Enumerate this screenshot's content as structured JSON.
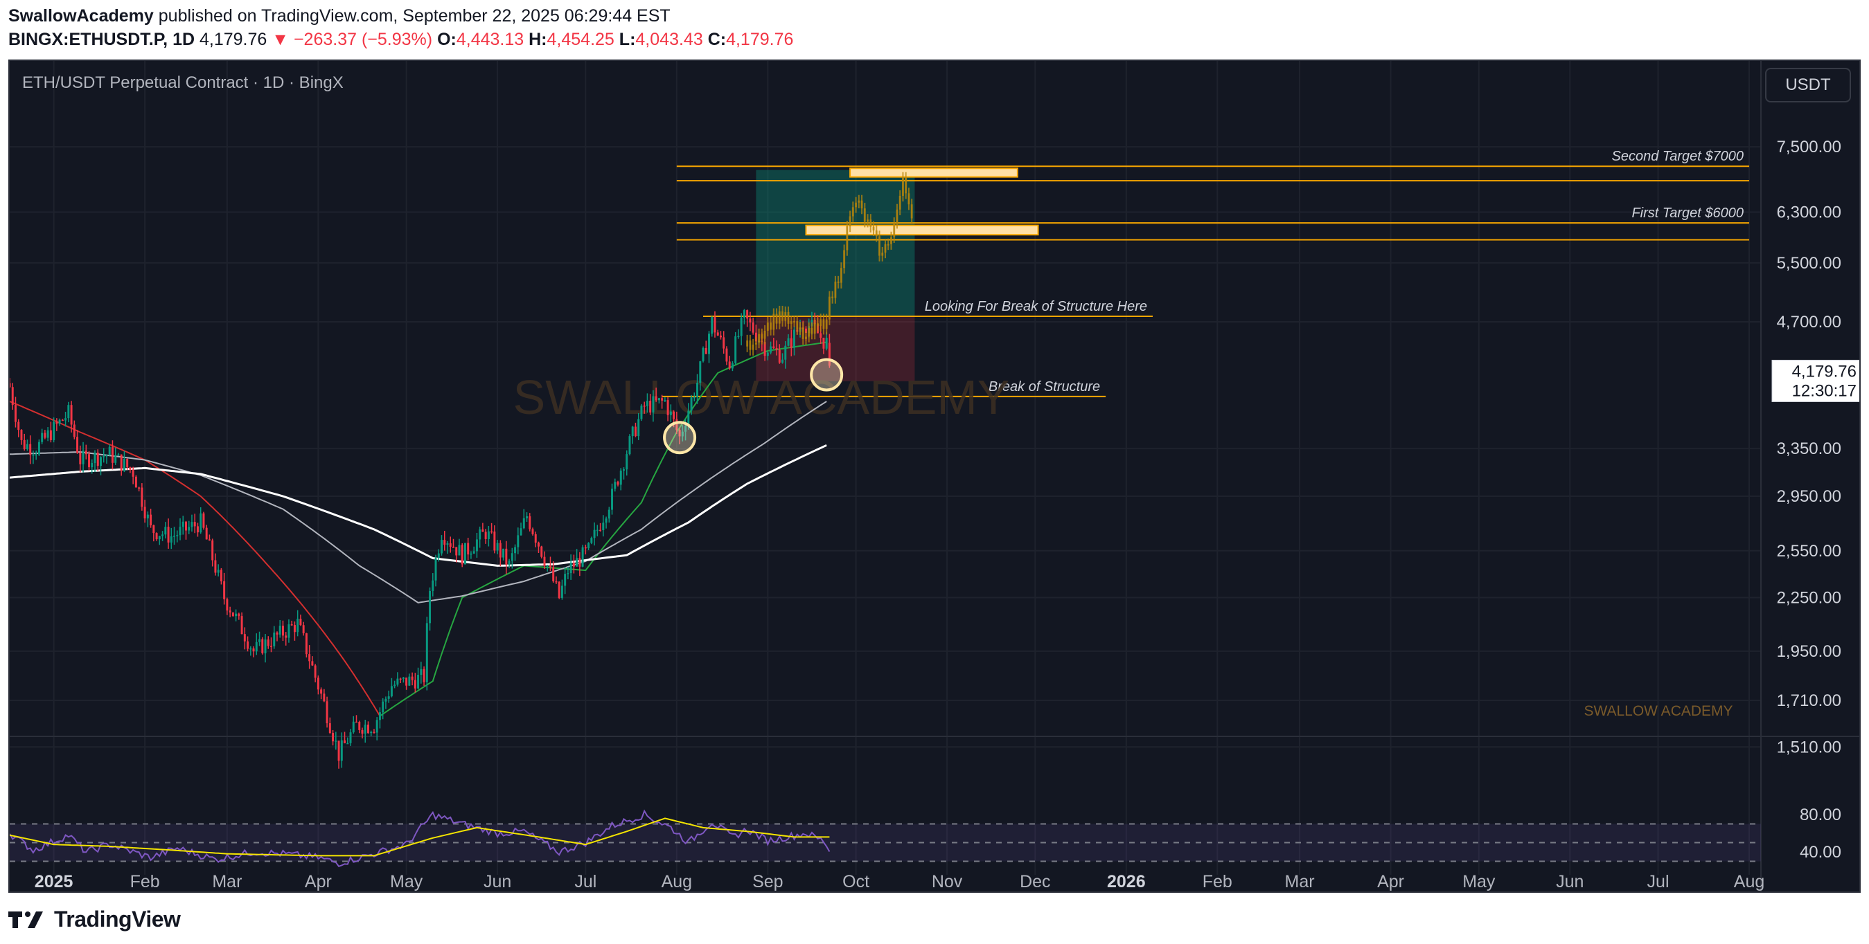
{
  "header": {
    "author": "SwallowAcademy",
    "published_text": "published on TradingView.com, September 22, 2025 06:29:44 EST",
    "symbol": "BINGX:ETHUSDT.P, 1D",
    "last": "4,179.76",
    "change": "▼ −263.37 (−5.93%)",
    "o_label": "O:",
    "o": "4,443.13",
    "h_label": "H:",
    "h": "4,454.25",
    "l_label": "L:",
    "l": "4,043.43",
    "c_label": "C:",
    "c": "4,179.76"
  },
  "panel": {
    "title": "ETH/USDT Perpetual Contract · 1D · BingX",
    "currency": "USDT",
    "watermark": "SWALLOW ACADEMY",
    "watermark_small": "SWALLOW ACADEMY"
  },
  "footer": {
    "brand": "TradingView"
  },
  "colors": {
    "background": "#131722",
    "up": "#089981",
    "down": "#f23645",
    "level": "#f7a600",
    "ema_short": "#26a641",
    "ema_mid": "#d32f2f",
    "ma_gray": "#b2b5be",
    "ma_white": "#ffffff",
    "rsi": "#7e57c2",
    "rsi_ma": "#f5e500"
  },
  "chart_data": {
    "type": "candlestick",
    "symbol": "ETHUSDT.P",
    "timeframe": "1D",
    "y_scale": "log",
    "ylim": [
      1380,
      7900
    ],
    "price_ticks": [
      7500,
      6300,
      5500,
      4700,
      3350,
      2950,
      2550,
      2250,
      1950,
      1710,
      1510
    ],
    "price_tick_labels": [
      "7,500.00",
      "6,300.00",
      "5,500.00",
      "4,700.00",
      "3,350.00",
      "2,950.00",
      "2,550.00",
      "2,250.00",
      "1,950.00",
      "1,710.00",
      "1,510.00"
    ],
    "last_price": 4179.76,
    "last_price_label": "4,179.76",
    "countdown_label": "12:30:17",
    "x_start": "2024-12-17",
    "x_end": "2026-08-05",
    "x_ticks": [
      {
        "date": "2025-01-01",
        "label": "2025",
        "bold": true
      },
      {
        "date": "2025-02-01",
        "label": "Feb"
      },
      {
        "date": "2025-03-01",
        "label": "Mar"
      },
      {
        "date": "2025-04-01",
        "label": "Apr"
      },
      {
        "date": "2025-05-01",
        "label": "May"
      },
      {
        "date": "2025-06-01",
        "label": "Jun"
      },
      {
        "date": "2025-07-01",
        "label": "Jul"
      },
      {
        "date": "2025-08-01",
        "label": "Aug"
      },
      {
        "date": "2025-09-01",
        "label": "Sep"
      },
      {
        "date": "2025-10-01",
        "label": "Oct"
      },
      {
        "date": "2025-11-01",
        "label": "Nov"
      },
      {
        "date": "2025-12-01",
        "label": "Dec"
      },
      {
        "date": "2026-01-01",
        "label": "2026",
        "bold": true
      },
      {
        "date": "2026-02-01",
        "label": "Feb"
      },
      {
        "date": "2026-03-01",
        "label": "Mar"
      },
      {
        "date": "2026-04-01",
        "label": "Apr"
      },
      {
        "date": "2026-05-01",
        "label": "May"
      },
      {
        "date": "2026-06-01",
        "label": "Jun"
      },
      {
        "date": "2026-07-01",
        "label": "Jul"
      },
      {
        "date": "2026-08-01",
        "label": "Aug"
      }
    ],
    "close_anchors": [
      [
        "2024-12-17",
        3950
      ],
      [
        "2024-12-21",
        3400
      ],
      [
        "2024-12-26",
        3350
      ],
      [
        "2025-01-06",
        3680
      ],
      [
        "2025-01-10",
        3250
      ],
      [
        "2025-01-20",
        3300
      ],
      [
        "2025-01-28",
        3150
      ],
      [
        "2025-02-03",
        2700
      ],
      [
        "2025-02-10",
        2650
      ],
      [
        "2025-02-20",
        2750
      ],
      [
        "2025-02-28",
        2250
      ],
      [
        "2025-03-10",
        1950
      ],
      [
        "2025-03-20",
        2050
      ],
      [
        "2025-03-25",
        2100
      ],
      [
        "2025-03-31",
        1820
      ],
      [
        "2025-04-08",
        1480
      ],
      [
        "2025-04-14",
        1600
      ],
      [
        "2025-04-20",
        1600
      ],
      [
        "2025-04-26",
        1780
      ],
      [
        "2025-05-07",
        1820
      ],
      [
        "2025-05-09",
        2300
      ],
      [
        "2025-05-13",
        2680
      ],
      [
        "2025-05-20",
        2520
      ],
      [
        "2025-05-28",
        2680
      ],
      [
        "2025-06-05",
        2450
      ],
      [
        "2025-06-11",
        2800
      ],
      [
        "2025-06-17",
        2500
      ],
      [
        "2025-06-22",
        2250
      ],
      [
        "2025-06-25",
        2420
      ],
      [
        "2025-07-02",
        2550
      ],
      [
        "2025-07-10",
        2950
      ],
      [
        "2025-07-16",
        3400
      ],
      [
        "2025-07-21",
        3750
      ],
      [
        "2025-07-28",
        3800
      ],
      [
        "2025-08-02",
        3450
      ],
      [
        "2025-08-08",
        4000
      ],
      [
        "2025-08-13",
        4700
      ],
      [
        "2025-08-19",
        4200
      ],
      [
        "2025-08-24",
        4750
      ],
      [
        "2025-08-31",
        4400
      ],
      [
        "2025-09-06",
        4300
      ],
      [
        "2025-09-13",
        4700
      ],
      [
        "2025-09-17",
        4600
      ],
      [
        "2025-09-20",
        4470
      ],
      [
        "2025-09-21",
        4443.13
      ],
      [
        "2025-09-22",
        4179.76
      ]
    ],
    "projection_anchors": [
      [
        "2025-08-25",
        4400
      ],
      [
        "2025-09-05",
        4800
      ],
      [
        "2025-09-14",
        4500
      ],
      [
        "2025-09-20",
        4700
      ],
      [
        "2025-09-25",
        5300
      ],
      [
        "2025-09-28",
        6000
      ],
      [
        "2025-10-01",
        6500
      ],
      [
        "2025-10-05",
        6100
      ],
      [
        "2025-10-10",
        5600
      ],
      [
        "2025-10-14",
        6100
      ],
      [
        "2025-10-17",
        6800
      ],
      [
        "2025-10-20",
        6300
      ]
    ],
    "moving_averages": [
      {
        "color": "ema_short",
        "anchors": [
          [
            "2025-04-22",
            1640
          ],
          [
            "2025-05-10",
            1800
          ],
          [
            "2025-05-20",
            2250
          ],
          [
            "2025-06-10",
            2450
          ],
          [
            "2025-07-01",
            2420
          ],
          [
            "2025-07-20",
            2900
          ],
          [
            "2025-08-01",
            3500
          ],
          [
            "2025-08-15",
            4100
          ],
          [
            "2025-09-01",
            4350
          ],
          [
            "2025-09-21",
            4450
          ]
        ]
      },
      {
        "color": "ema_mid",
        "anchors": [
          [
            "2024-12-17",
            3800
          ],
          [
            "2025-01-10",
            3500
          ],
          [
            "2025-02-01",
            3250
          ],
          [
            "2025-02-20",
            2950
          ],
          [
            "2025-03-15",
            2450
          ],
          [
            "2025-04-10",
            1900
          ],
          [
            "2025-04-22",
            1640
          ]
        ]
      },
      {
        "color": "ma_gray",
        "anchors": [
          [
            "2024-12-17",
            3300
          ],
          [
            "2025-01-10",
            3320
          ],
          [
            "2025-02-01",
            3250
          ],
          [
            "2025-02-20",
            3120
          ],
          [
            "2025-03-20",
            2850
          ],
          [
            "2025-04-15",
            2450
          ],
          [
            "2025-05-05",
            2220
          ],
          [
            "2025-05-20",
            2260
          ],
          [
            "2025-06-10",
            2350
          ],
          [
            "2025-07-01",
            2480
          ],
          [
            "2025-07-20",
            2700
          ],
          [
            "2025-08-10",
            3050
          ],
          [
            "2025-08-31",
            3400
          ],
          [
            "2025-09-21",
            3800
          ]
        ]
      },
      {
        "color": "ma_white",
        "anchors": [
          [
            "2024-12-17",
            3100
          ],
          [
            "2025-01-10",
            3150
          ],
          [
            "2025-02-01",
            3180
          ],
          [
            "2025-02-20",
            3130
          ],
          [
            "2025-03-20",
            2950
          ],
          [
            "2025-04-20",
            2700
          ],
          [
            "2025-05-10",
            2500
          ],
          [
            "2025-06-01",
            2450
          ],
          [
            "2025-06-20",
            2460
          ],
          [
            "2025-07-15",
            2520
          ],
          [
            "2025-08-05",
            2750
          ],
          [
            "2025-08-25",
            3050
          ],
          [
            "2025-09-21",
            3380
          ]
        ]
      }
    ],
    "levels": [
      {
        "label": "Second Target $7000",
        "low": 6850,
        "high": 7120,
        "x_from": "2025-08-01",
        "x_to": "2026-08-01"
      },
      {
        "label": "First Target $6000",
        "low": 5850,
        "high": 6120,
        "x_from": "2025-08-01",
        "x_to": "2026-08-01"
      },
      {
        "label": "Looking For Break of Structure Here",
        "price": 4770,
        "x_from": "2025-08-10",
        "x_to": "2026-01-10"
      },
      {
        "label": "Break of Structure",
        "price": 3850,
        "x_from": "2025-07-27",
        "x_to": "2025-12-25"
      }
    ],
    "position": {
      "x_from": "2025-08-28",
      "x_to": "2025-10-21",
      "entry": 4770,
      "stop": 4010,
      "target": 7050
    },
    "highlights": [
      {
        "x_from": "2025-09-29",
        "x_to": "2025-11-25",
        "low": 6920,
        "high": 7080
      },
      {
        "x_from": "2025-09-14",
        "x_to": "2025-12-02",
        "low": 5930,
        "high": 6080
      }
    ],
    "circles": [
      {
        "date": "2025-08-02",
        "price": 3450
      },
      {
        "date": "2025-09-21",
        "price": 4080
      }
    ],
    "rsi": {
      "ylim": [
        20,
        100
      ],
      "ticks": [
        80,
        40
      ],
      "tick_labels": [
        "80.00",
        "40.00"
      ],
      "band_lines": [
        70,
        50,
        30
      ],
      "anchors": [
        [
          "2024-12-17",
          60
        ],
        [
          "2024-12-25",
          42
        ],
        [
          "2025-01-06",
          58
        ],
        [
          "2025-01-12",
          40
        ],
        [
          "2025-01-20",
          48
        ],
        [
          "2025-02-03",
          34
        ],
        [
          "2025-02-12",
          44
        ],
        [
          "2025-02-25",
          32
        ],
        [
          "2025-03-10",
          40
        ],
        [
          "2025-03-20",
          38
        ],
        [
          "2025-04-01",
          34
        ],
        [
          "2025-04-08",
          28
        ],
        [
          "2025-04-20",
          38
        ],
        [
          "2025-05-01",
          48
        ],
        [
          "2025-05-10",
          80
        ],
        [
          "2025-05-20",
          70
        ],
        [
          "2025-06-01",
          60
        ],
        [
          "2025-06-10",
          62
        ],
        [
          "2025-06-22",
          40
        ],
        [
          "2025-07-01",
          50
        ],
        [
          "2025-07-10",
          68
        ],
        [
          "2025-07-21",
          80
        ],
        [
          "2025-07-30",
          66
        ],
        [
          "2025-08-05",
          50
        ],
        [
          "2025-08-13",
          72
        ],
        [
          "2025-08-20",
          56
        ],
        [
          "2025-08-25",
          64
        ],
        [
          "2025-09-01",
          52
        ],
        [
          "2025-09-14",
          60
        ],
        [
          "2025-09-20",
          52
        ],
        [
          "2025-09-22",
          42
        ]
      ],
      "ma_anchors": [
        [
          "2024-12-17",
          58
        ],
        [
          "2025-01-01",
          48
        ],
        [
          "2025-01-20",
          46
        ],
        [
          "2025-02-10",
          42
        ],
        [
          "2025-03-01",
          38
        ],
        [
          "2025-04-01",
          36
        ],
        [
          "2025-04-20",
          36
        ],
        [
          "2025-05-10",
          55
        ],
        [
          "2025-05-25",
          66
        ],
        [
          "2025-06-15",
          56
        ],
        [
          "2025-07-01",
          48
        ],
        [
          "2025-07-15",
          62
        ],
        [
          "2025-07-28",
          76
        ],
        [
          "2025-08-10",
          66
        ],
        [
          "2025-08-25",
          62
        ],
        [
          "2025-09-10",
          56
        ],
        [
          "2025-09-22",
          56
        ]
      ]
    }
  }
}
